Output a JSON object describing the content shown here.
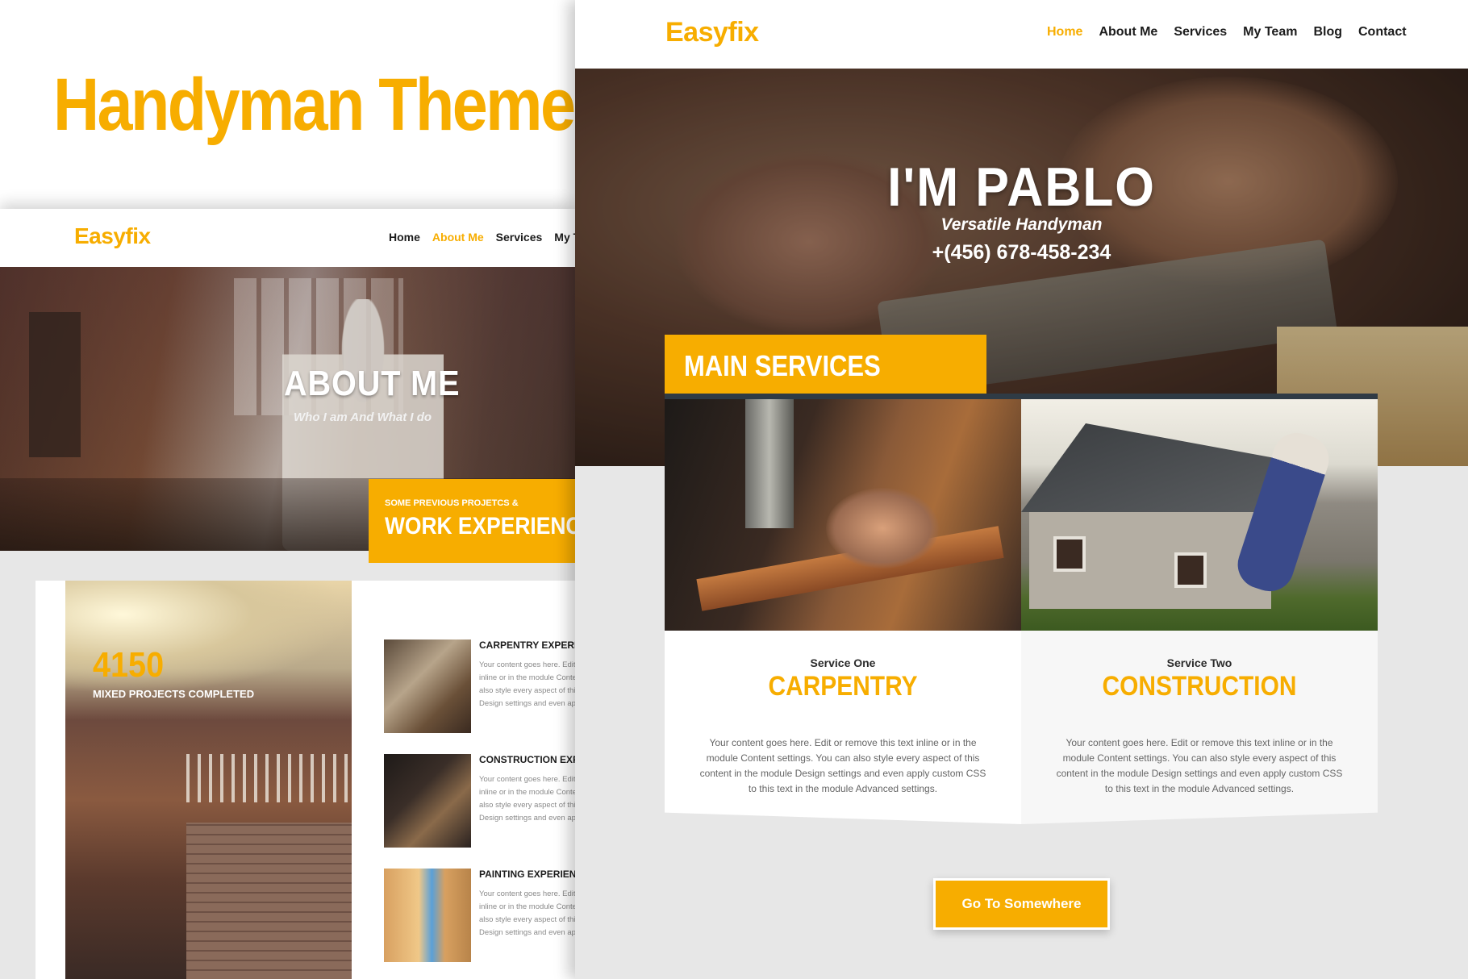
{
  "heading": {
    "title": "Handyman Theme"
  },
  "about_page": {
    "logo": "Easyfix",
    "nav": [
      "Home",
      "About Me",
      "Services",
      "My Team"
    ],
    "active_nav": "About Me",
    "hero_title": "ABOUT ME",
    "hero_subtitle": "Who I am And What I do",
    "work_small": "SOME PREVIOUS PROJETCS &",
    "work_big": "WORK EXPERIENCE",
    "stat": {
      "number": "4150",
      "label": "MIXED PROJECTS COMPLETED"
    },
    "experiences": [
      {
        "title": "CARPENTRY EXPERIENCE",
        "lines": [
          "Your content goes here. Edit or",
          "inline or in the module Content",
          "also style every aspect of this",
          "Design settings and even apply"
        ]
      },
      {
        "title": "CONSTRUCTION EXPERIENCE",
        "lines": [
          "Your content goes here. Edit or",
          "inline or in the module Content",
          "also style every aspect of this",
          "Design settings and even apply"
        ]
      },
      {
        "title": "PAINTING EXPERIENCE",
        "lines": [
          "Your content goes here. Edit or",
          "inline or in the module Content",
          "also style every aspect of this",
          "Design settings and even apply"
        ]
      }
    ]
  },
  "home_page": {
    "logo": "Easyfix",
    "nav": [
      "Home",
      "About Me",
      "Services",
      "My Team",
      "Blog",
      "Contact"
    ],
    "active_nav": "Home",
    "hero_title": "I'M PABLO",
    "hero_role": "Versatile Handyman",
    "hero_phone": "+(456) 678-458-234",
    "main_services_label": "MAIN SERVICES",
    "services": [
      {
        "kicker": "Service One",
        "title": "CARPENTRY",
        "text": "Your content goes here. Edit or remove this text inline or in the module Content settings. You can also style every aspect of this content in the module Design settings and even apply custom CSS to this text in the module Advanced settings."
      },
      {
        "kicker": "Service Two",
        "title": "CONSTRUCTION",
        "text": "Your content goes here. Edit or remove this text inline or in the module Content settings. You can also style every aspect of this content in the module Design settings and even apply custom CSS to this text in the module Advanced settings."
      }
    ],
    "cta_label": "Go To Somewhere"
  },
  "colors": {
    "accent": "#f7ad00",
    "dark_bar": "#2f3b45",
    "page_bg": "#e7e7e7"
  }
}
